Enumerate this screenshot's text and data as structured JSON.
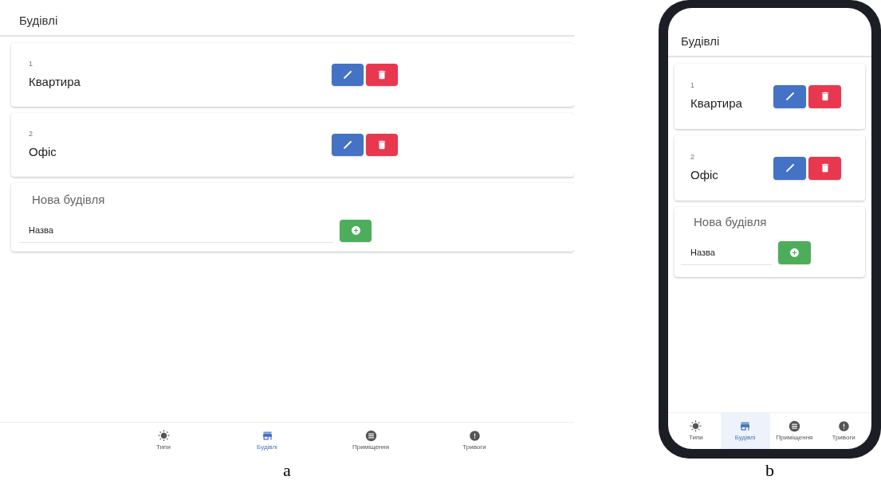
{
  "figures": [
    {
      "caption": "a",
      "kind": "tablet",
      "title": "Будівлі",
      "buildings": [
        {
          "number": "1",
          "name": "Квартира"
        },
        {
          "number": "2",
          "name": "Офіс"
        }
      ],
      "new_building": {
        "heading": "Нова будівля",
        "placeholder": "Назва"
      },
      "nav": [
        {
          "label": "Типи",
          "kind": "sun",
          "selected": false
        },
        {
          "label": "Будівлі",
          "kind": "store",
          "selected": true
        },
        {
          "label": "Приміщення",
          "kind": "list",
          "selected": false
        },
        {
          "label": "Тривоги",
          "kind": "alert",
          "selected": false
        }
      ]
    },
    {
      "caption": "b",
      "kind": "phone",
      "title": "Будівлі",
      "buildings": [
        {
          "number": "1",
          "name": "Квартира"
        },
        {
          "number": "2",
          "name": "Офіс"
        }
      ],
      "new_building": {
        "heading": "Нова будівля",
        "placeholder": "Назва"
      },
      "nav": [
        {
          "label": "Типи",
          "kind": "sun",
          "selected": false
        },
        {
          "label": "Будівлі",
          "kind": "store",
          "selected": true
        },
        {
          "label": "Приміщення",
          "kind": "list",
          "selected": false
        },
        {
          "label": "Тривоги",
          "kind": "alert",
          "selected": false
        }
      ]
    }
  ]
}
